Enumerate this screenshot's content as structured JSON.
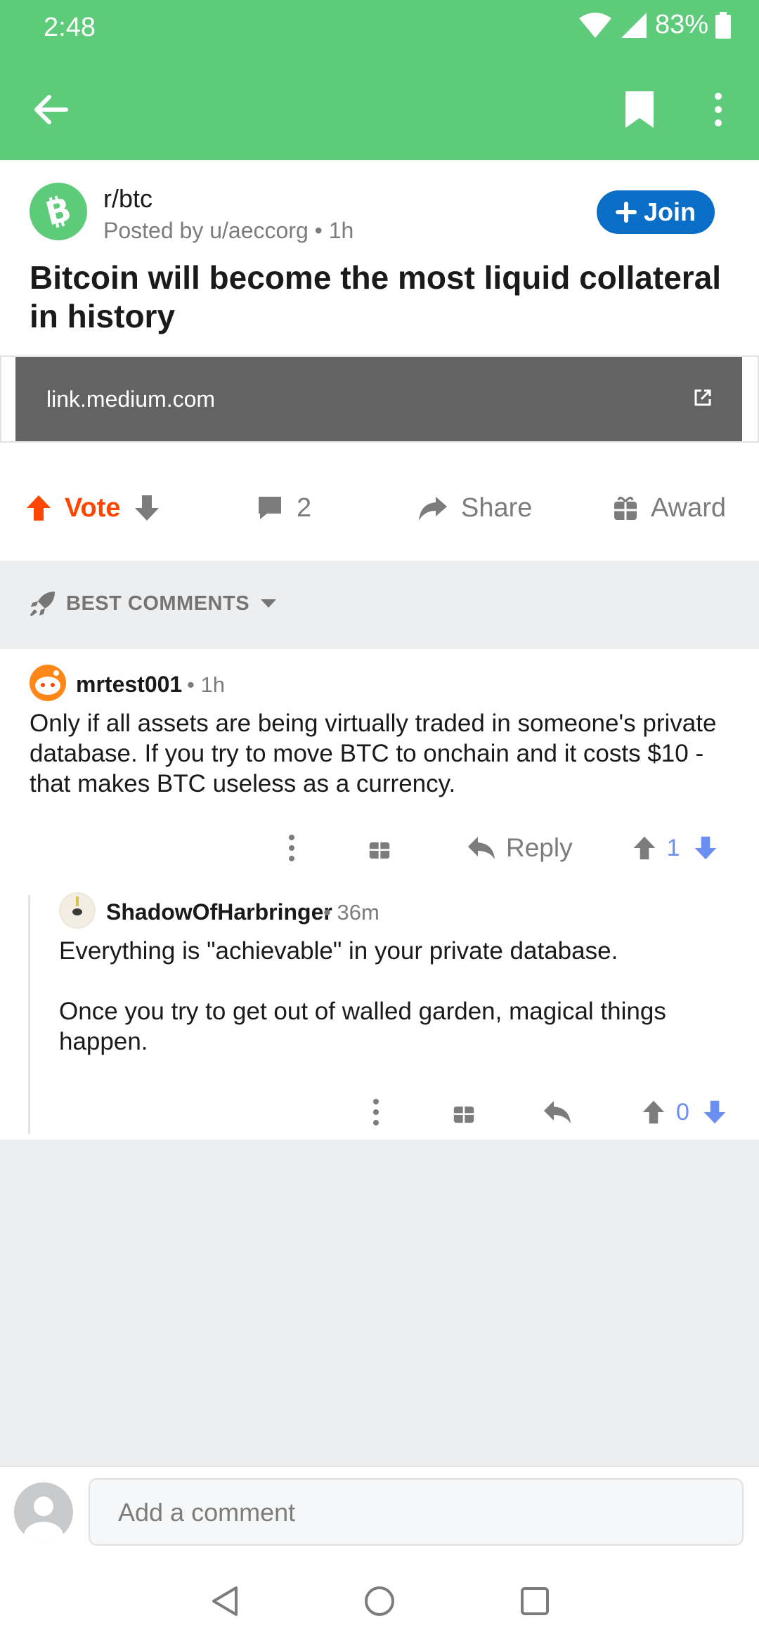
{
  "status_bar": {
    "time": "2:48",
    "battery": "83%"
  },
  "post": {
    "subreddit": "r/btc",
    "posted_by": "Posted by u/aeccorg • 1h",
    "join_label": "Join",
    "title": "Bitcoin will become the most liquid collateral in history",
    "link": "link.medium.com",
    "vote_label": "Vote",
    "comment_count": "2",
    "share_label": "Share",
    "award_label": "Award"
  },
  "sort": {
    "label": "BEST COMMENTS"
  },
  "comments": [
    {
      "author": "mrtest001",
      "time": "• 1h",
      "body": "Only if all assets are being virtually traded in someone's private database.  If you try to move BTC to onchain and it costs $10 - that makes BTC useless as a currency.",
      "reply_label": "Reply",
      "score": "1"
    },
    {
      "author": "ShadowOfHarbringer",
      "time": "• 36m",
      "body_line1": "Everything is \"achievable\" in your private database.",
      "body_line2": "Once you try to get out of walled garden, magical things happen.",
      "score": "0"
    }
  ],
  "composer": {
    "placeholder": "Add a comment"
  },
  "colors": {
    "accent": "#5ecb7a",
    "join": "#0a6ec7",
    "upvote": "#ff4500",
    "score": "#6a8ff2"
  }
}
